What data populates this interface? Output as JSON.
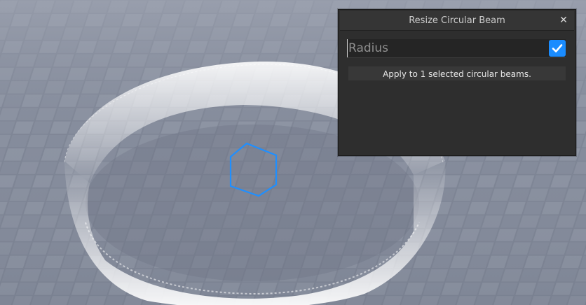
{
  "widget": {
    "title": "Resize Circular Beam",
    "close_label": "✕",
    "radius_placeholder": "Radius",
    "radius_value": "",
    "checkbox_checked": true,
    "apply_label": "Apply to 1 selected circular beams."
  },
  "colors": {
    "accent": "#1a8cff",
    "panel_bg": "#2e2e2e",
    "titlebar_bg": "#353535",
    "ground": "#7f8696",
    "beam": "#ffffff",
    "selection_hexagon": "#1f8fff"
  },
  "icons": {
    "close": "close-icon",
    "check": "check-icon",
    "selection": "selection-hexagon-icon"
  }
}
